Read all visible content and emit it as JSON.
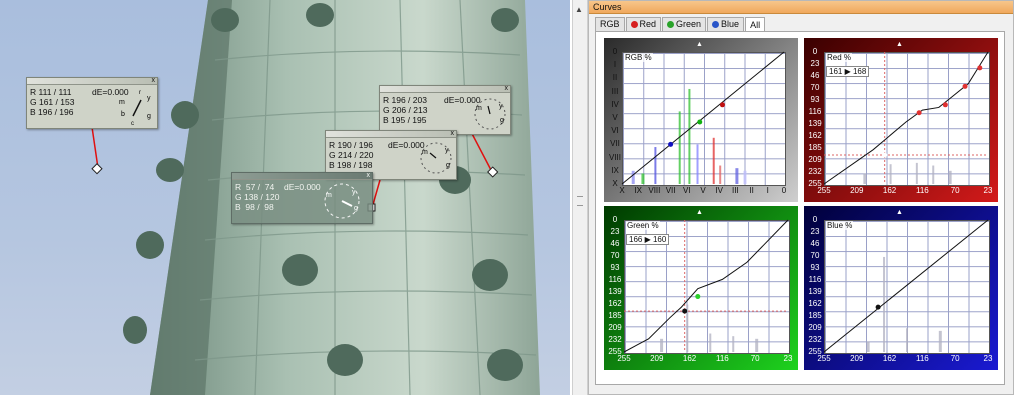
{
  "window": {
    "title": "Curves"
  },
  "tabs": [
    {
      "label": "RGB",
      "dot": "",
      "active": false
    },
    {
      "label": "Red",
      "dot": "#d62020",
      "active": false
    },
    {
      "label": "Green",
      "dot": "#2aa32a",
      "active": false
    },
    {
      "label": "Blue",
      "dot": "#2a56c8",
      "active": false
    },
    {
      "label": "All",
      "dot": "",
      "active": true
    }
  ],
  "probes": [
    {
      "r": "R 111 / 111",
      "g": "G 161 / 153",
      "b": "B 196 / 196",
      "de": "dE=0.000",
      "close": "x"
    },
    {
      "r": "R 196 / 203",
      "g": "G 206 / 213",
      "b": "B 195 / 195",
      "de": "dE=0.000",
      "close": "x"
    },
    {
      "r": "R 190 / 196",
      "g": "G 214 / 220",
      "b": "B 198 / 198",
      "de": "dE=0.000",
      "close": "x"
    },
    {
      "r": "R  57 /  74",
      "g": "G 138 / 120",
      "b": "B  98 /  98",
      "de": "dE=0.000",
      "close": "x"
    }
  ],
  "dial": {
    "m": "m",
    "y": "y",
    "b": "b",
    "g": "g",
    "c": "c",
    "r": "r"
  },
  "rgb_curve": {
    "label": "RGB %",
    "zones_y": [
      "0",
      "I",
      "II",
      "III",
      "IV",
      "V",
      "VI",
      "VII",
      "VIII",
      "IX",
      "X"
    ],
    "zones_x": [
      "X",
      "IX",
      "VIII",
      "VII",
      "VI",
      "V",
      "IV",
      "III",
      "II",
      "I",
      "0"
    ]
  },
  "red_curve": {
    "label": "Red %",
    "ticks_y": [
      "0",
      "23",
      "46",
      "70",
      "93",
      "116",
      "139",
      "162",
      "185",
      "209",
      "232",
      "255"
    ],
    "ticks_x": [
      "255",
      "209",
      "162",
      "116",
      "70",
      "23"
    ],
    "readout_in": "161",
    "readout_out": "168",
    "color": "#b01010"
  },
  "green_curve": {
    "label": "Green %",
    "ticks_y": [
      "0",
      "23",
      "46",
      "70",
      "93",
      "116",
      "139",
      "162",
      "185",
      "209",
      "232",
      "255"
    ],
    "ticks_x": [
      "255",
      "209",
      "162",
      "116",
      "70",
      "23"
    ],
    "readout_in": "166",
    "readout_out": "160",
    "color": "#10a010"
  },
  "blue_curve": {
    "label": "Blue %",
    "ticks_y": [
      "0",
      "23",
      "46",
      "70",
      "93",
      "116",
      "139",
      "162",
      "185",
      "209",
      "232",
      "255"
    ],
    "ticks_x": [
      "255",
      "209",
      "162",
      "116",
      "70",
      "23"
    ],
    "color": "#1010a0"
  },
  "colors": {
    "accent": "#f0a85c",
    "sky": "#b0c3e0",
    "copper": "#8fa89a"
  }
}
